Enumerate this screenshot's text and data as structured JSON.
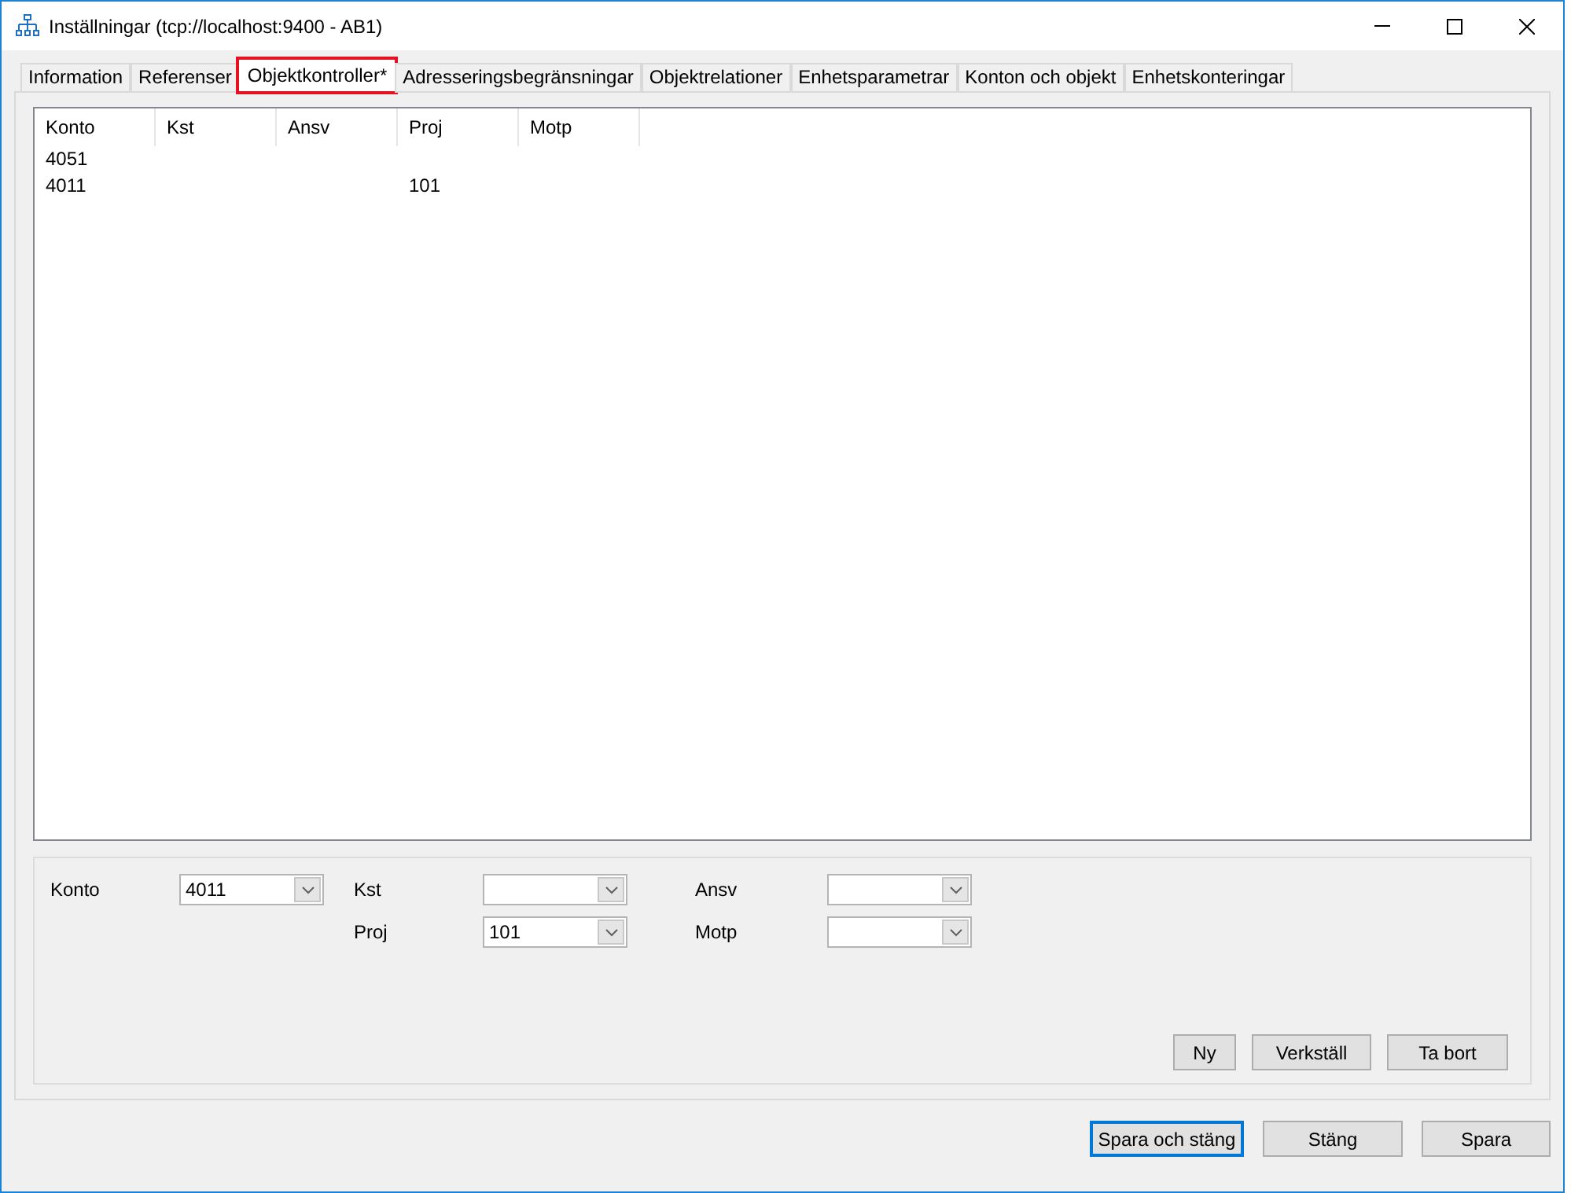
{
  "window": {
    "title": "Inställningar (tcp://localhost:9400 - AB1)"
  },
  "tabs": [
    {
      "label": "Information",
      "selected": false,
      "highlighted": false
    },
    {
      "label": "Referenser",
      "selected": false,
      "highlighted": false
    },
    {
      "label": "Objektkontroller*",
      "selected": true,
      "highlighted": true
    },
    {
      "label": "Adresseringsbegränsningar",
      "selected": false,
      "highlighted": false
    },
    {
      "label": "Objektrelationer",
      "selected": false,
      "highlighted": false
    },
    {
      "label": "Enhetsparametrar",
      "selected": false,
      "highlighted": false
    },
    {
      "label": "Konton och objekt",
      "selected": false,
      "highlighted": false
    },
    {
      "label": "Enhetskonteringar",
      "selected": false,
      "highlighted": false
    }
  ],
  "list": {
    "columns": [
      "Konto",
      "Kst",
      "Ansv",
      "Proj",
      "Motp"
    ],
    "rows": [
      {
        "konto": "4051"
      },
      {
        "konto": "4011",
        "proj": "101"
      }
    ]
  },
  "fields": [
    {
      "label": "Konto",
      "value": "4011"
    },
    {
      "label": "Kst"
    },
    {
      "label": "Ansv"
    },
    {
      "label": "Proj",
      "value": "101"
    },
    {
      "label": "Motp"
    }
  ],
  "panel_buttons": [
    "Ny",
    "Verkställ",
    "Ta bort"
  ],
  "dialog_buttons": [
    {
      "label": "Spara och stäng",
      "default": true
    },
    {
      "label": "Stäng",
      "default": false
    },
    {
      "label": "Spara",
      "default": false
    }
  ]
}
